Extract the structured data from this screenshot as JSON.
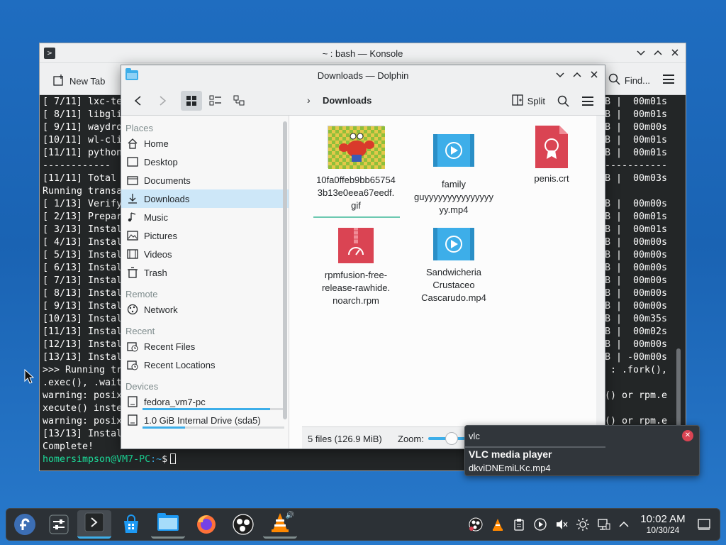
{
  "konsole": {
    "title": "~ : bash — Konsole",
    "new_tab_label": "New Tab",
    "find_label": "Find...",
    "terminal_lines": [
      "[ 7/11] lxc-te",
      "[ 8/11] libgli",
      "[ 9/11] waydro",
      "[10/11] wl-cli",
      "[11/11] python",
      "------------",
      "[11/11] Total ",
      "Running transa",
      "[ 1/13] Verify",
      "[ 2/13] Prepar",
      "[ 3/13] Instal",
      "[ 4/13] Instal",
      "[ 5/13] Instal",
      "[ 6/13] Instal",
      "[ 7/13] Instal",
      "[ 8/13] Instal",
      "[ 9/13] Instal",
      "[10/13] Instal",
      "[11/13] Instal",
      "[12/13] Instal",
      "[13/13] Instal",
      ">>> Running tr",
      ".exec(), .wait",
      "warning: posix",
      "xecute() inste",
      "warning: posix",
      "[13/13] Instal",
      "Complete!"
    ],
    "terminal_right_lines": [
      "B |  00m01s",
      "B |  00m01s",
      "B |  00m00s",
      "B |  00m01s",
      "B |  00m01s",
      "-----------",
      "B |  00m03s",
      "",
      "B |  00m00s",
      "B |  00m01s",
      "B |  00m01s",
      "B |  00m00s",
      "B |  00m00s",
      "B |  00m00s",
      "B |  00m00s",
      "B |  00m00s",
      "B |  00m00s",
      "B |  00m35s",
      "B |  00m02s",
      "B |  00m00s",
      "B | -00m00s",
      ": .fork(),",
      "",
      "() or rpm.e",
      "",
      "() or rpm.e",
      "",
      ""
    ],
    "prompt_user": "homersimpson@VM7-PC",
    "prompt_cwd": ":~",
    "prompt_symbol": "$"
  },
  "dolphin": {
    "title": "Downloads — Dolphin",
    "breadcrumb": "Downloads",
    "split_label": "Split",
    "places": {
      "section_places": "Places",
      "items": [
        "Home",
        "Desktop",
        "Documents",
        "Downloads",
        "Music",
        "Pictures",
        "Videos",
        "Trash"
      ],
      "section_remote": "Remote",
      "remote_items": [
        "Network"
      ],
      "section_recent": "Recent",
      "recent_items": [
        "Recent Files",
        "Recent Locations"
      ],
      "section_devices": "Devices",
      "devices": [
        {
          "name": "fedora_vm7-pc",
          "usage": 0.9
        },
        {
          "name": "1.0 GiB Internal Drive (sda5)",
          "usage": 0.3
        }
      ]
    },
    "files": [
      {
        "name": "10fa0ffeb9bb65754\n3b13e0eea67eedf.\ngif",
        "kind": "gif"
      },
      {
        "name": "family\nguyyyyyyyyyyyyyyy\nyy.mp4",
        "kind": "video"
      },
      {
        "name": "penis.crt",
        "kind": "cert"
      },
      {
        "name": "rpmfusion-free-\nrelease-rawhide.\nnoarch.rpm",
        "kind": "rpm"
      },
      {
        "name": "Sandwicheria\nCrustaceo\nCascarudo.mp4",
        "kind": "video"
      }
    ],
    "status_text": "5 files (126.9 MiB)",
    "zoom_label": "Zoom:"
  },
  "notification": {
    "app": "vlc",
    "title": "VLC media player",
    "body": "dkviDNEmiLKc.mp4"
  },
  "taskbar": {
    "time": "10:02 AM",
    "date": "10/30/24"
  },
  "colors": {
    "accent": "#3daee9",
    "desktop": "#1f6dc0",
    "terminal_bg": "#232627",
    "prompt_user": "#1cdc9a"
  }
}
